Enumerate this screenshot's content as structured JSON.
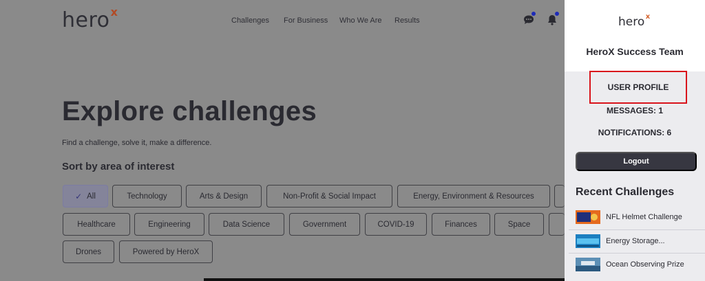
{
  "header": {
    "logo": "hero",
    "logo_mark": "x",
    "nav": [
      "Challenges",
      "For Business",
      "Who We Are",
      "Results"
    ],
    "icons": {
      "messages": "chat-bubble-icon",
      "notifications": "bell-icon"
    }
  },
  "hero": {
    "title": "Explore challenges",
    "subtitle": "Find a challenge, solve it, make a difference.",
    "sort_title": "Sort by area of interest"
  },
  "filters": {
    "row1": [
      "All",
      "Technology",
      "Arts & Design",
      "Non-Profit & Social Impact",
      "Energy, Environment & Resources"
    ],
    "row2": [
      "Healthcare",
      "Engineering",
      "Data Science",
      "Government",
      "COVID-19",
      "Finances",
      "Space"
    ],
    "row3": [
      "Drones",
      "Powered by HeroX"
    ],
    "active": "All"
  },
  "panel": {
    "logo": "hero",
    "logo_mark": "x",
    "team_name": "HeroX Success Team",
    "user_profile": "USER PROFILE",
    "messages": "MESSAGES: 1",
    "notifications": "NOTIFICATIONS: 6",
    "logout": "Logout",
    "recent_title": "Recent Challenges",
    "recent": [
      "NFL Helmet Challenge",
      "Energy Storage...",
      "Ocean Observing Prize"
    ]
  },
  "colors": {
    "accent_red": "#d9131b",
    "brand_orange": "#d4622d",
    "dark_button": "#373741",
    "notification_dot": "#1e2bb8"
  }
}
